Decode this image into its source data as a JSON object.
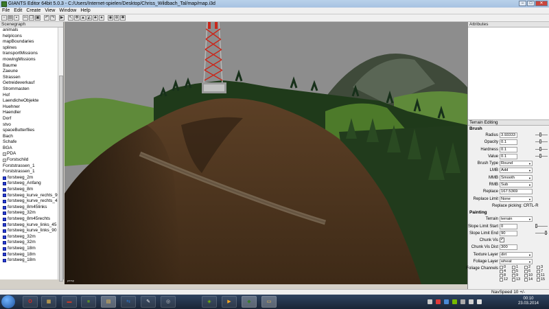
{
  "window": {
    "title": "GIANTS Editor 64bit 5.0.3 - C:/Users/Internet-spielen/Desktop/Chriss_Wildbach_Tal/map/map.i3d",
    "buttons": [
      "–",
      "□",
      "✕"
    ]
  },
  "menu": [
    "File",
    "Edit",
    "Create",
    "View",
    "Window",
    "Help"
  ],
  "toolbar_icons": [
    "new-file-icon",
    "open-file-icon",
    "save-icon",
    "cut-icon",
    "copy-icon",
    "paste-icon",
    "undo-icon",
    "redo-icon",
    "play-icon",
    "select-icon",
    "move-icon",
    "terrain-icon",
    "terrain-paint-icon",
    "foliage-icon",
    "grass-icon",
    "camera-icon",
    "zoom-icon",
    "render-icon"
  ],
  "scenegraph": {
    "title": "Scenegraph",
    "items": [
      {
        "label": "animals",
        "type": "group"
      },
      {
        "label": "helpIcons",
        "type": "group"
      },
      {
        "label": "mapBoundaries",
        "type": "group"
      },
      {
        "label": "splines",
        "type": "group"
      },
      {
        "label": "transportMissions",
        "type": "group"
      },
      {
        "label": "mowingMissions",
        "type": "group"
      },
      {
        "label": "Baume",
        "type": "group"
      },
      {
        "label": "Zaeune",
        "type": "group"
      },
      {
        "label": "Strassen",
        "type": "group"
      },
      {
        "label": "Getreideverkauf",
        "type": "group"
      },
      {
        "label": "Strommasten",
        "type": "group"
      },
      {
        "label": "Hof",
        "type": "group"
      },
      {
        "label": "LaendicheObjekte",
        "type": "group"
      },
      {
        "label": "Huehner",
        "type": "group"
      },
      {
        "label": "Haendler",
        "type": "group"
      },
      {
        "label": "Dorf",
        "type": "group"
      },
      {
        "label": "stvo",
        "type": "group"
      },
      {
        "label": "spaceButterflies",
        "type": "group"
      },
      {
        "label": "Bach",
        "type": "group"
      },
      {
        "label": "Schafe",
        "type": "group"
      },
      {
        "label": "BGA",
        "type": "group"
      },
      {
        "label": "PDA",
        "type": "expand"
      },
      {
        "label": "Forstschild",
        "type": "expand"
      },
      {
        "label": "Forststrassen_1",
        "type": "group"
      },
      {
        "label": "Forststrassen_1",
        "type": "group"
      },
      {
        "label": "forstweg_2m",
        "type": "mesh"
      },
      {
        "label": "forstweg_Anfang",
        "type": "mesh"
      },
      {
        "label": "forstweg_8m",
        "type": "mesh"
      },
      {
        "label": "forstweg_kurve_rechts_90",
        "type": "mesh"
      },
      {
        "label": "forstweg_kurve_rechts_45",
        "type": "mesh"
      },
      {
        "label": "forstweg_8m45links",
        "type": "mesh"
      },
      {
        "label": "forstweg_32m",
        "type": "mesh"
      },
      {
        "label": "forstweg_8m45rechts",
        "type": "mesh"
      },
      {
        "label": "forstweg_kurve_links_45",
        "type": "mesh"
      },
      {
        "label": "forstweg_kurve_links_90",
        "type": "mesh"
      },
      {
        "label": "forstweg_32m",
        "type": "mesh"
      },
      {
        "label": "forstweg_32m",
        "type": "mesh"
      },
      {
        "label": "forstweg_18m",
        "type": "mesh"
      },
      {
        "label": "forstweg_18m",
        "type": "mesh"
      },
      {
        "label": "forstweg_18m",
        "type": "mesh"
      }
    ]
  },
  "attributes": {
    "title": "Attributes"
  },
  "terrain_editing": {
    "title": "Terrain Editing",
    "brush_header": "Brush",
    "radius_label": "Radius",
    "radius_value": "3.93333",
    "opacity_label": "Opacity",
    "opacity_value": "0.1",
    "hardness_label": "Hardness",
    "hardness_value": "0.1",
    "value_label": "Value",
    "value_value": "0.1",
    "brush_type_label": "Brush Type",
    "brush_type_value": "Round",
    "lmb_label": "LMB",
    "lmb_value": "Add",
    "mmb_label": "MMB",
    "mmb_value": "Smooth",
    "rmb_label": "RMB",
    "rmb_value": "Sub",
    "replace_label": "Replace",
    "replace_value": "167.5369",
    "replace_limit_label": "Replace Limit",
    "replace_limit_value": "None",
    "replace_picking": "Replace picking: CRTL-R",
    "painting_header": "Painting",
    "terrain_label": "Terrain",
    "terrain_value": "terrain",
    "slope_start_label": "Slope Limit Start",
    "slope_start_value": "0",
    "slope_end_label": "Slope Limit End",
    "slope_end_value": "90",
    "chunk_vis_label": "Chunk Vis",
    "chunk_vis_dist_label": "Chunk Vis Dist",
    "chunk_vis_dist_value": "300",
    "texture_layer_label": "Texture Layer",
    "texture_layer_value": "dirt",
    "foliage_layer_label": "Foliage Layer",
    "foliage_layer_value": "wheat",
    "foliage_channels_label": "Foliage Channels",
    "foliage_channels": [
      "0",
      "1",
      "2",
      "3",
      "4",
      "5",
      "6",
      "7",
      "8",
      "9",
      "10",
      "11",
      "12",
      "13",
      "14",
      "15"
    ]
  },
  "viewport": {
    "label": "persp"
  },
  "status": {
    "navspeed": "NavSpeed 10 +/-"
  },
  "taskbar": {
    "apps": [
      "start-orb",
      "opera-icon",
      "archive-icon",
      "game-icon",
      "minecraft-icon",
      "explorer-icon",
      "teamviewer-icon",
      "paint-icon",
      "steam-icon",
      "nvidia-icon",
      "media-player-icon",
      "giants-editor-icon",
      "folder-icon"
    ],
    "time": "00:10",
    "date": "23.03.2014"
  },
  "colors": {
    "sky": "#8d8d8d",
    "dirt": "#5a3a1f",
    "grass": "#4d7a2a",
    "forest": "#1f3a1a",
    "mast_red": "#c8281c",
    "selection_cube": "#2a3fd6"
  }
}
